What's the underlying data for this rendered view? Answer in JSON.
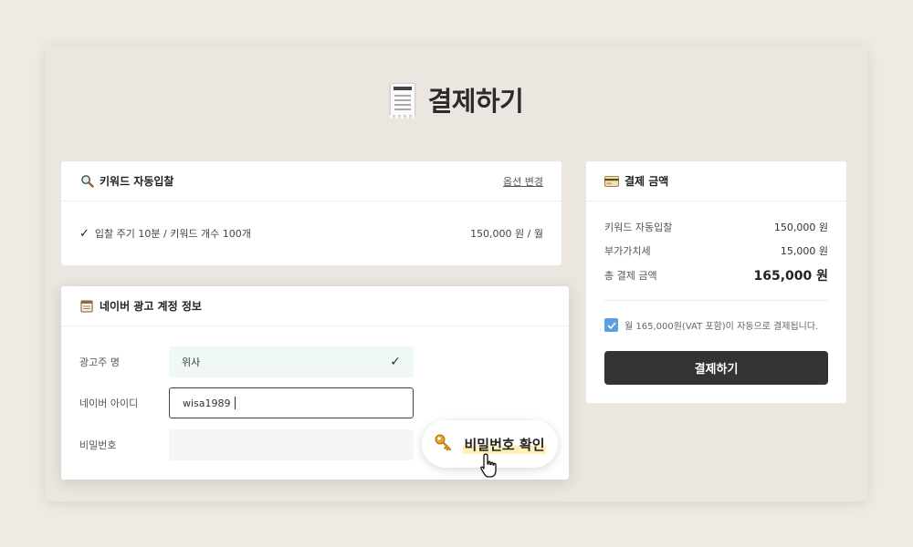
{
  "page": {
    "title": "결제하기"
  },
  "keyword_card": {
    "title": "키워드 자동입찰",
    "option_link": "옵션 변경",
    "item": {
      "check": "✓",
      "text": "입찰 주기 10분 / 키워드 개수 100개",
      "price": "150,000 원 / 월"
    }
  },
  "account_card": {
    "title": "네이버 광고 계정 정보",
    "fields": [
      {
        "label": "광고주 명",
        "value": "위사",
        "status": "✓"
      },
      {
        "label": "네이버 아이디",
        "value": "wisa1989"
      },
      {
        "label": "비밀번호",
        "value": ""
      }
    ],
    "verify_button": "비밀번호 확인"
  },
  "payment_card": {
    "title": "결제 금액",
    "rows": [
      {
        "label": "키워드 자동입찰",
        "value": "150,000 원"
      },
      {
        "label": "부가가치세",
        "value": "15,000 원"
      },
      {
        "label": "총 결제 금액",
        "value": "165,000 원"
      }
    ],
    "agree_text": "월 165,000원(VAT 포함)이 자동으로 결제됩니다.",
    "agree_checked": true,
    "pay_button": "결제하기"
  },
  "icons": {
    "title": "receipt-icon",
    "keyword": "magnifier-icon",
    "account": "notepad-icon",
    "payment": "credit-card-icon",
    "verify": "key-icon",
    "pointer": "hand-pointer-icon"
  },
  "colors": {
    "accent_checkbox": "#5a9fe0",
    "button_dark": "#333333",
    "highlight": "#fdf0b8",
    "confirmed_field": "#f0f8f7"
  }
}
